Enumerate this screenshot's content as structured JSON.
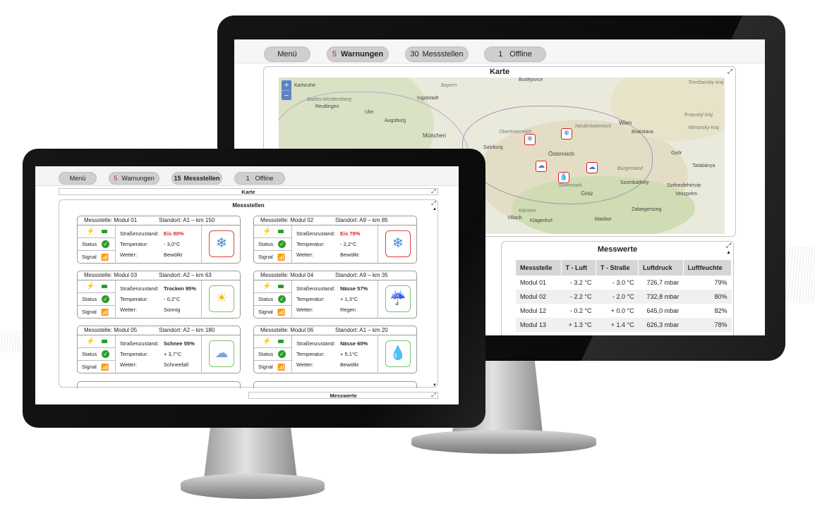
{
  "back_screen": {
    "nav": {
      "menu": "Menü",
      "warnings_count": "5",
      "warnings_label": "Warnungen",
      "stations_count": "30",
      "stations_label": "Messstellen",
      "offline_count": "1",
      "offline_label": "Offline"
    },
    "map_panel": {
      "title": "Karte",
      "zoom_in": "+",
      "zoom_out": "−",
      "cities": [
        "Karlsruhe",
        "Budějovice",
        "Bayern",
        "Ingolstadt",
        "Baden-Württemberg",
        "Reutlingen",
        "Ulm",
        "Augsburg",
        "München",
        "Oberösterreich",
        "Niederösterreich",
        "Wien",
        "Bratislava",
        "Salzburg",
        "Österreich",
        "Burgenland",
        "Graz",
        "Szombathely",
        "Győr",
        "Tatabánya",
        "Székesfehérvár",
        "Veszprém",
        "Villach",
        "Klagenfurt",
        "Maribor",
        "Zalaegerszeg",
        "Kärnten",
        "Steiermark",
        "Trenčiansky kraj",
        "Trnavský kraj",
        "Nitriansky kraj"
      ]
    },
    "measurements_panel": {
      "title": "Messwerte",
      "columns": [
        "Messstelle",
        "T - Luft",
        "T - Straße",
        "Luftdruck",
        "Luftfeuchte"
      ],
      "rows": [
        [
          "Modul 01",
          "- 3.2 °C",
          "- 3.0 °C",
          "726,7 mbar",
          "79%"
        ],
        [
          "Modul 02",
          "- 2.2 °C",
          "- 2.0 °C",
          "732,8 mbar",
          "80%"
        ],
        [
          "Modul 12",
          "- 0.2 °C",
          "+ 0.0 °C",
          "645,0 mbar",
          "82%"
        ],
        [
          "Modul 13",
          "+ 1.3 °C",
          "+ 1.4 °C",
          "626,3 mbar",
          "78%"
        ]
      ]
    }
  },
  "front_screen": {
    "nav": {
      "menu": "Menü",
      "warnings_count": "5",
      "warnings_label": "Warnungen",
      "stations_count": "15",
      "stations_label": "Messstellen",
      "offline_count": "1",
      "offline_label": "Offline"
    },
    "map_bar_title": "Karte",
    "stations_panel_title": "Messstellen",
    "measurements_bar_title": "Messwerte",
    "labels": {
      "status": "Status",
      "signal": "Signal",
      "road": "Straßenzustand:",
      "temp": "Temperatur:",
      "weather": "Wetter:"
    },
    "stations": [
      {
        "name": "Messstelle: Modul 01",
        "location": "Standort: A1 – km 150",
        "road": "Eis 80%",
        "road_alert": true,
        "temp": "- 3,0°C",
        "weather": "Bewölkt",
        "icon": "snowflake-icon",
        "glyph": "❄",
        "frame": "red",
        "color": "#3d86d8"
      },
      {
        "name": "Messstelle: Modul 02",
        "location": "Standort: A9 – km 85",
        "road": "Eis 78%",
        "road_alert": true,
        "temp": "- 2,2°C",
        "weather": "Bewölkt",
        "icon": "snowflake-icon",
        "glyph": "❄",
        "frame": "red",
        "color": "#3d86d8"
      },
      {
        "name": "Messstelle: Modul 03",
        "location": "Standort: A2 – km 63",
        "road": "Trocken 95%",
        "road_alert": false,
        "temp": "- 0,2°C",
        "weather": "Sonnig",
        "icon": "sun-icon",
        "glyph": "☀",
        "frame": "green",
        "color": "#e8c020"
      },
      {
        "name": "Messstelle: Modul 04",
        "location": "Standort: A9 – km 35",
        "road": "Nässe 57%",
        "road_alert": false,
        "temp": "+ 1,3°C",
        "weather": "Regen",
        "icon": "rain-cloud-icon",
        "glyph": "☔",
        "frame": "green",
        "color": "#7ba7d6"
      },
      {
        "name": "Messstelle: Modul 05",
        "location": "Standort: A2 – km 180",
        "road": "Schnee 55%",
        "road_alert": false,
        "temp": "+ 3,7°C",
        "weather": "Schneefall",
        "icon": "snow-cloud-icon",
        "glyph": "☁",
        "frame": "green",
        "color": "#7ba7d6"
      },
      {
        "name": "Messstelle: Modul 06",
        "location": "Standort: A1 – km 20",
        "road": "Nässe 60%",
        "road_alert": false,
        "temp": "+ 5,1°C",
        "weather": "Bewölkt",
        "icon": "water-drop-icon",
        "glyph": "💧",
        "frame": "green",
        "color": "#3d86d8"
      }
    ]
  }
}
